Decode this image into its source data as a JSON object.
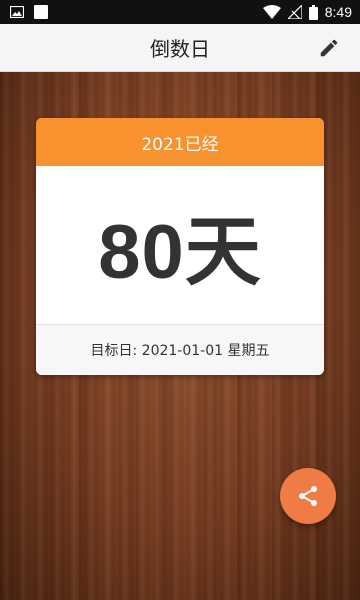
{
  "status_bar": {
    "time": "8:49",
    "icons": [
      "image-icon",
      "square-icon",
      "wifi-icon",
      "signal-icon",
      "battery-icon"
    ]
  },
  "app_bar": {
    "title": "倒数日",
    "edit_icon": "pencil-icon"
  },
  "card": {
    "header": "2021已经",
    "count": "80天",
    "footer": "目标日: 2021-01-01 星期五"
  },
  "fab": {
    "icon": "share-icon"
  },
  "colors": {
    "accent": "#f7922f",
    "fab": "#ef7b45",
    "app_bar": "#f5f5f5"
  }
}
